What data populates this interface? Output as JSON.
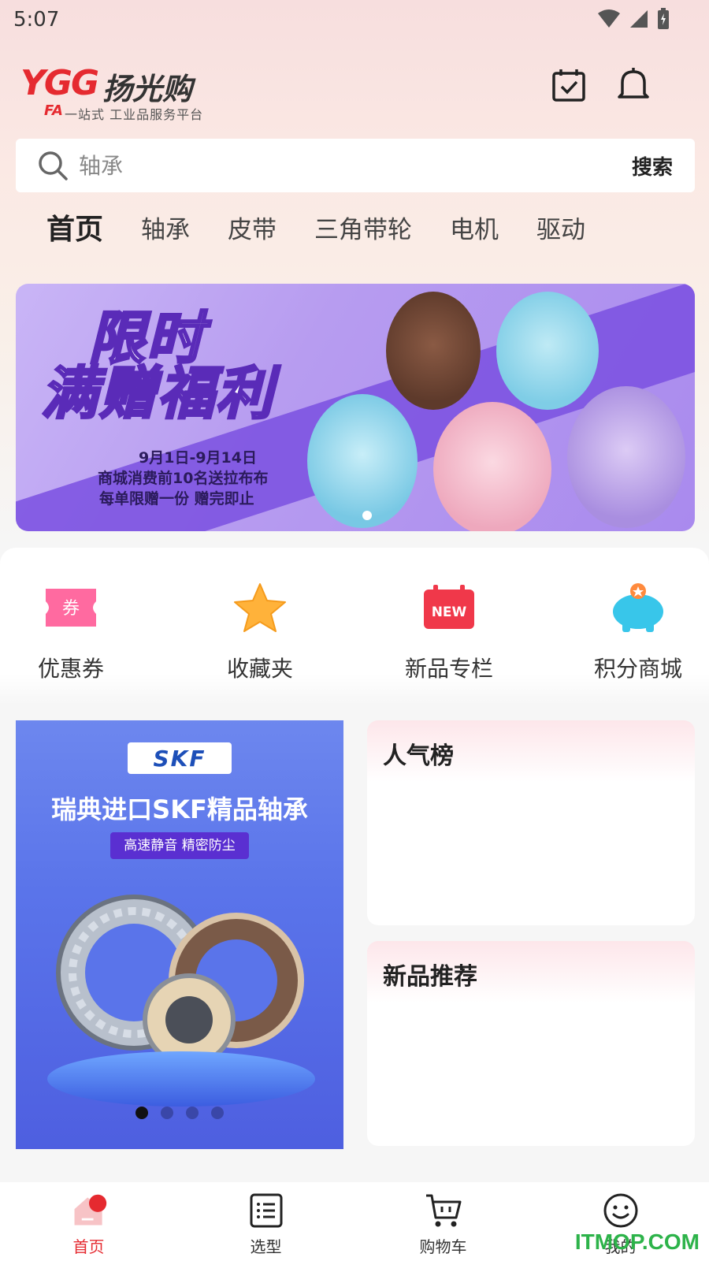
{
  "status_bar": {
    "time": "5:07"
  },
  "header": {
    "logo_mark": "YGG",
    "logo_name": "扬光购",
    "logo_fa": "FA",
    "logo_tagline": "一站式 工业品服务平台"
  },
  "search": {
    "placeholder": "轴承",
    "button_label": "搜索"
  },
  "tabs": [
    {
      "label": "首页",
      "active": true
    },
    {
      "label": "轴承"
    },
    {
      "label": "皮带"
    },
    {
      "label": "三角带轮"
    },
    {
      "label": "电机"
    },
    {
      "label": "驱动"
    }
  ],
  "banner": {
    "title_line1": "限时",
    "title_line2": "满赠福利",
    "date": "9月1日-9月14日",
    "line2": "商城消费前10名送拉布布",
    "line3": "每单限赠一份 赠完即止",
    "colors": {
      "bg": "#b79cf0",
      "stripe": "#7a50e0"
    }
  },
  "quick_links": [
    {
      "label": "优惠券",
      "icon": "coupon-icon"
    },
    {
      "label": "收藏夹",
      "icon": "star-icon"
    },
    {
      "label": "新品专栏",
      "icon": "new-badge-icon",
      "badge_text": "NEW"
    },
    {
      "label": "积分商城",
      "icon": "piggy-bank-icon"
    }
  ],
  "coupon_icon_text": "券",
  "promo": {
    "brand": "SKF",
    "title": "瑞典进口SKF精品轴承",
    "subtitle": "高速静音 精密防尘",
    "dots_total": 4,
    "dots_active_index": 0
  },
  "cards": {
    "popular_title": "人气榜",
    "new_title": "新品推荐"
  },
  "bottom_nav": [
    {
      "label": "首页",
      "icon": "home-icon",
      "active": true
    },
    {
      "label": "选型",
      "icon": "list-icon"
    },
    {
      "label": "购物车",
      "icon": "cart-icon"
    },
    {
      "label": "我的",
      "icon": "smiley-icon"
    }
  ],
  "watermark": "ITMOP.COM",
  "colors": {
    "accent": "#e52a30"
  }
}
